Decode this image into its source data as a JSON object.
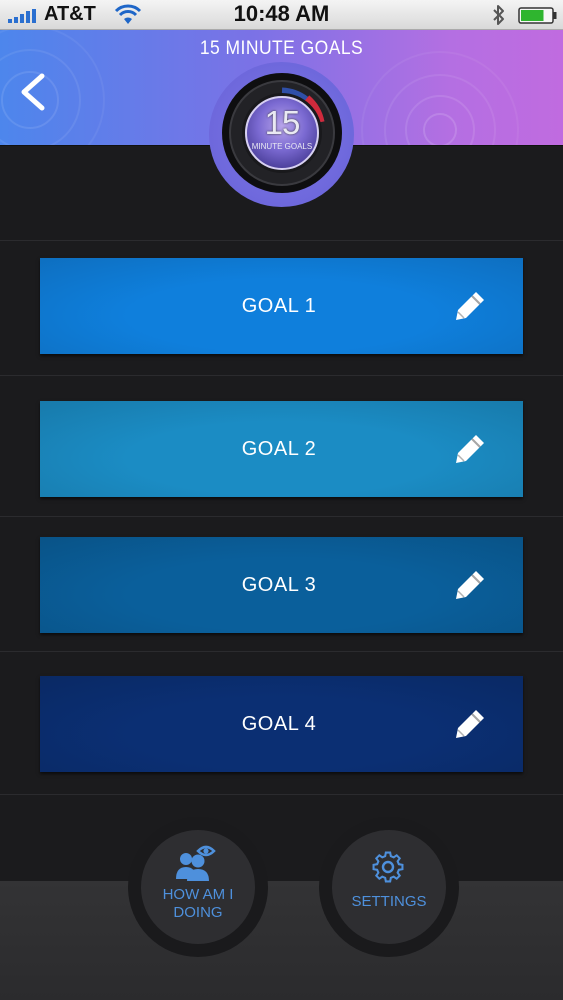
{
  "status_bar": {
    "carrier": "AT&T",
    "time": "10:48 AM",
    "battery_level": 0.75
  },
  "header": {
    "title": "15 MINUTE GOALS",
    "back_icon": "chevron-left-icon"
  },
  "dial": {
    "number": "15",
    "caption": "MINUTE GOALS"
  },
  "goals": [
    {
      "label": "GOAL 1",
      "color": "#0f7fdc",
      "edit_icon": "pencil-icon"
    },
    {
      "label": "GOAL 2",
      "color": "#1b8cc4",
      "edit_icon": "pencil-icon"
    },
    {
      "label": "GOAL 3",
      "color": "#0a5f9b",
      "edit_icon": "pencil-icon"
    },
    {
      "label": "GOAL 4",
      "color": "#0b2f73",
      "edit_icon": "pencil-icon"
    }
  ],
  "bottom": {
    "how_label_line1": "HOW AM I",
    "how_label_line2": "DOING",
    "how_icon": "people-eye-icon",
    "settings_label": "SETTINGS",
    "settings_icon": "gear-icon",
    "accent_color": "#4e90dc"
  }
}
